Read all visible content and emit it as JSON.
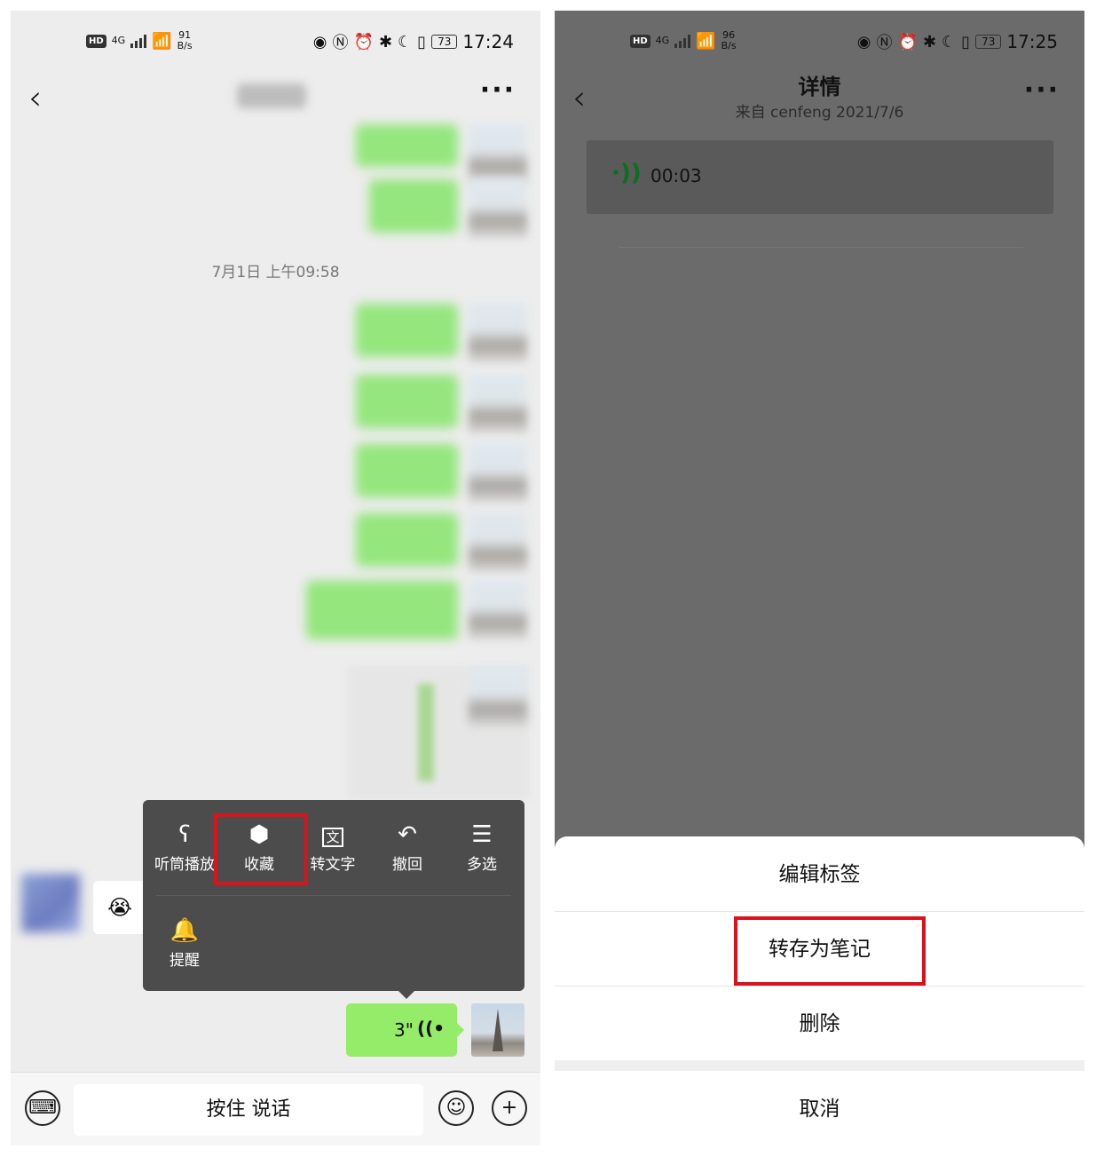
{
  "left": {
    "status": {
      "speed": "91",
      "speed_unit": "B/s",
      "network": "4G",
      "battery": "73",
      "time": "17:24"
    },
    "header": {
      "back_icon": "chevron-left-icon",
      "more_label": "···"
    },
    "timestamp": "7月1日 上午09:58",
    "context_menu": {
      "items": [
        {
          "icon": "ear-icon",
          "label": "听筒播放"
        },
        {
          "icon": "cube-icon",
          "label": "收藏"
        },
        {
          "icon": "text-icon",
          "label": "转文字"
        },
        {
          "icon": "undo-icon",
          "label": "撤回"
        },
        {
          "icon": "multiselect-icon",
          "label": "多选"
        },
        {
          "icon": "bell-icon",
          "label": "提醒"
        }
      ]
    },
    "voice_message": {
      "duration": "3\""
    },
    "input_bar": {
      "hold_to_talk": "按住 说话"
    }
  },
  "right": {
    "status": {
      "speed": "96",
      "speed_unit": "B/s",
      "network": "4G",
      "battery": "73",
      "time": "17:25"
    },
    "header": {
      "title": "详情",
      "subtitle": "来自 cenfeng 2021/7/6",
      "more_label": "···"
    },
    "voice_card": {
      "time": "00:03"
    },
    "action_sheet": {
      "items": [
        "编辑标签",
        "转存为笔记",
        "删除"
      ],
      "cancel": "取消"
    }
  },
  "colors": {
    "highlight": "#d9131d",
    "bubble_green": "#95ec69",
    "voice_icon": "#0c6f1b"
  }
}
